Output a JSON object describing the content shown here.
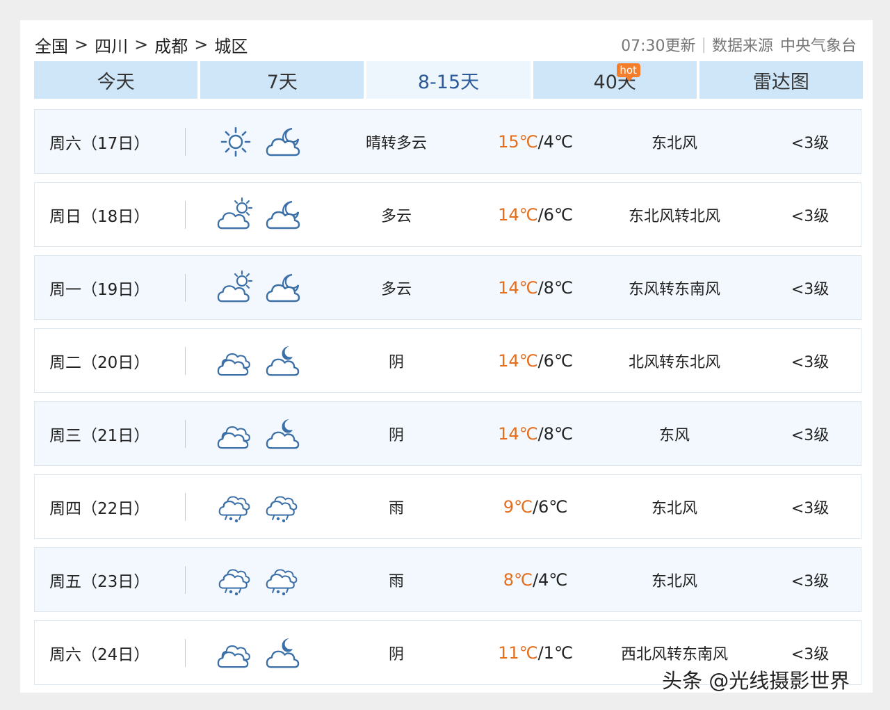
{
  "breadcrumb": [
    "全国",
    "四川",
    "成都",
    "城区"
  ],
  "breadcrumb_sep": ">",
  "meta": {
    "updated": "07:30更新",
    "divider": "|",
    "source_label": "数据来源",
    "source": "中央气象台"
  },
  "tabs": [
    {
      "label": "今天",
      "active": false
    },
    {
      "label": "7天",
      "active": false
    },
    {
      "label": "8-15天",
      "active": true
    },
    {
      "label": "40天",
      "active": false,
      "badge": "hot"
    },
    {
      "label": "雷达图",
      "active": false
    }
  ],
  "colors": {
    "tab_bg": "#cfe6f8",
    "tab_active_bg": "#eef6fd",
    "high_temp": "#e56e1d",
    "hot_badge": "#f57e2c",
    "icon": "#3b6fa8"
  },
  "forecast": [
    {
      "date": "周六（17日）",
      "icons": [
        "sun-icon",
        "cloudy-night-icon"
      ],
      "desc": "晴转多云",
      "high": "15℃",
      "low": "/4℃",
      "wind": "东北风",
      "level": "<3级"
    },
    {
      "date": "周日（18日）",
      "icons": [
        "partly-cloudy-day-icon",
        "cloudy-night-icon"
      ],
      "desc": "多云",
      "high": "14℃",
      "low": "/6℃",
      "wind": "东北风转北风",
      "level": "<3级"
    },
    {
      "date": "周一（19日）",
      "icons": [
        "partly-cloudy-day-icon",
        "cloudy-night-icon"
      ],
      "desc": "多云",
      "high": "14℃",
      "low": "/8℃",
      "wind": "东风转东南风",
      "level": "<3级"
    },
    {
      "date": "周二（20日）",
      "icons": [
        "overcast-icon",
        "overcast-night-icon"
      ],
      "desc": "阴",
      "high": "14℃",
      "low": "/6℃",
      "wind": "北风转东北风",
      "level": "<3级"
    },
    {
      "date": "周三（21日）",
      "icons": [
        "overcast-icon",
        "overcast-night-icon"
      ],
      "desc": "阴",
      "high": "14℃",
      "low": "/8℃",
      "wind": "东风",
      "level": "<3级"
    },
    {
      "date": "周四（22日）",
      "icons": [
        "rain-icon",
        "rain-icon"
      ],
      "desc": "雨",
      "high": "9℃",
      "low": "/6℃",
      "wind": "东北风",
      "level": "<3级"
    },
    {
      "date": "周五（23日）",
      "icons": [
        "rain-icon",
        "rain-icon"
      ],
      "desc": "雨",
      "high": "8℃",
      "low": "/4℃",
      "wind": "东北风",
      "level": "<3级"
    },
    {
      "date": "周六（24日）",
      "icons": [
        "overcast-icon",
        "overcast-night-icon"
      ],
      "desc": "阴",
      "high": "11℃",
      "low": "/1℃",
      "wind": "西北风转东南风",
      "level": "<3级"
    }
  ],
  "watermark": "头条 @光线摄影世界"
}
